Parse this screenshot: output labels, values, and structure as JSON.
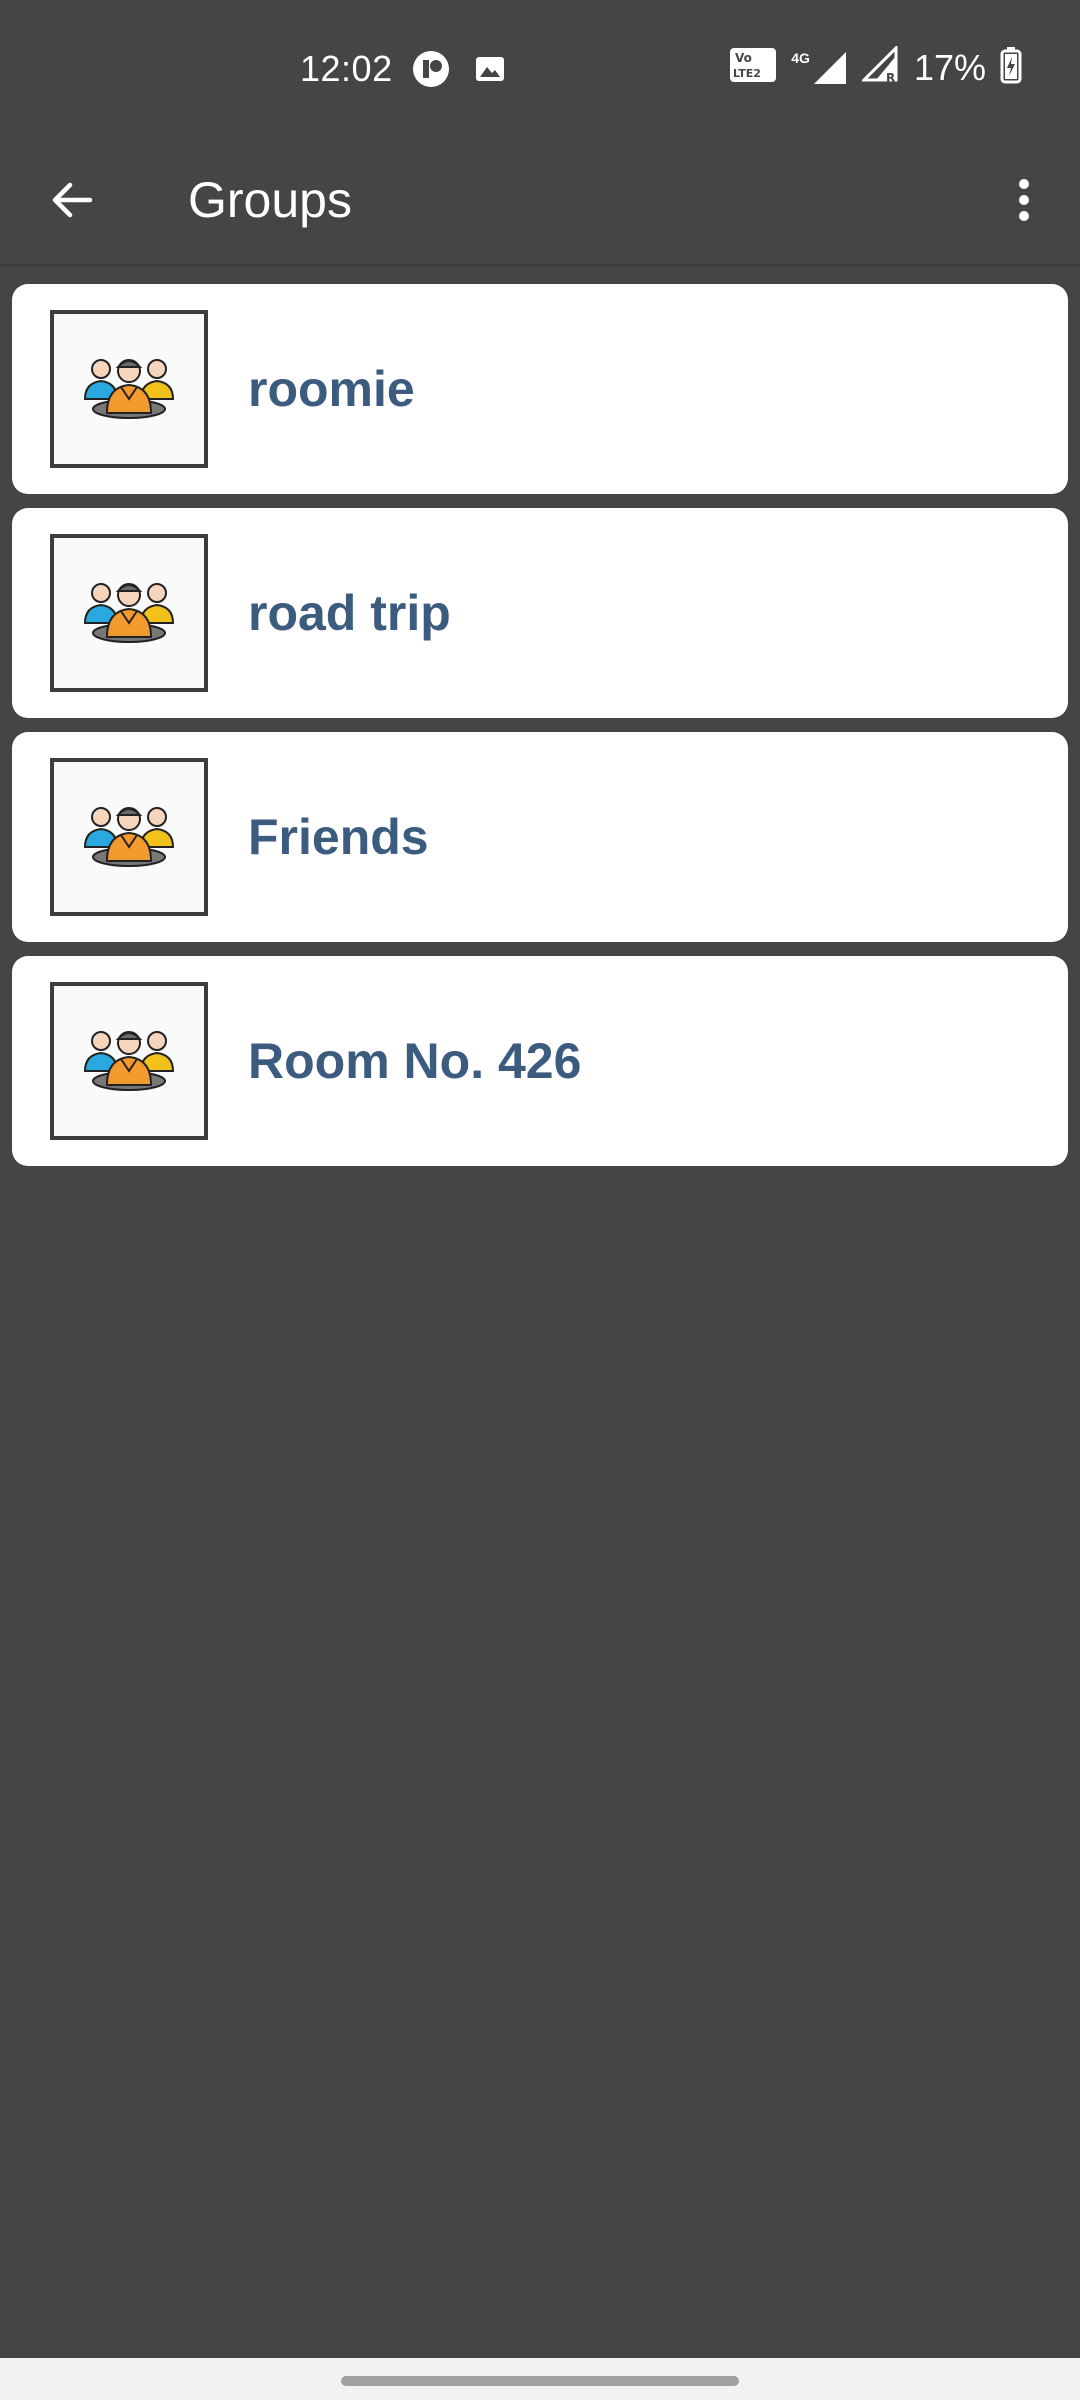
{
  "status_bar": {
    "time": "12:02",
    "battery": "17%",
    "network": "4G",
    "icons": [
      "app-notification-icon",
      "image-icon",
      "volte-icon",
      "signal-icon",
      "signal-roaming-icon",
      "battery-charging-icon"
    ]
  },
  "app_bar": {
    "title": "Groups",
    "back_icon": "arrow-back-icon",
    "menu_icon": "more-vert-icon"
  },
  "groups": [
    {
      "name": "roomie",
      "icon": "group-people-icon"
    },
    {
      "name": "road trip",
      "icon": "group-people-icon"
    },
    {
      "name": "Friends",
      "icon": "group-people-icon"
    },
    {
      "name": "Room No. 426",
      "icon": "group-people-icon"
    }
  ],
  "colors": {
    "background": "#454545",
    "card": "#ffffff",
    "group_name": "#3b5b7f"
  }
}
